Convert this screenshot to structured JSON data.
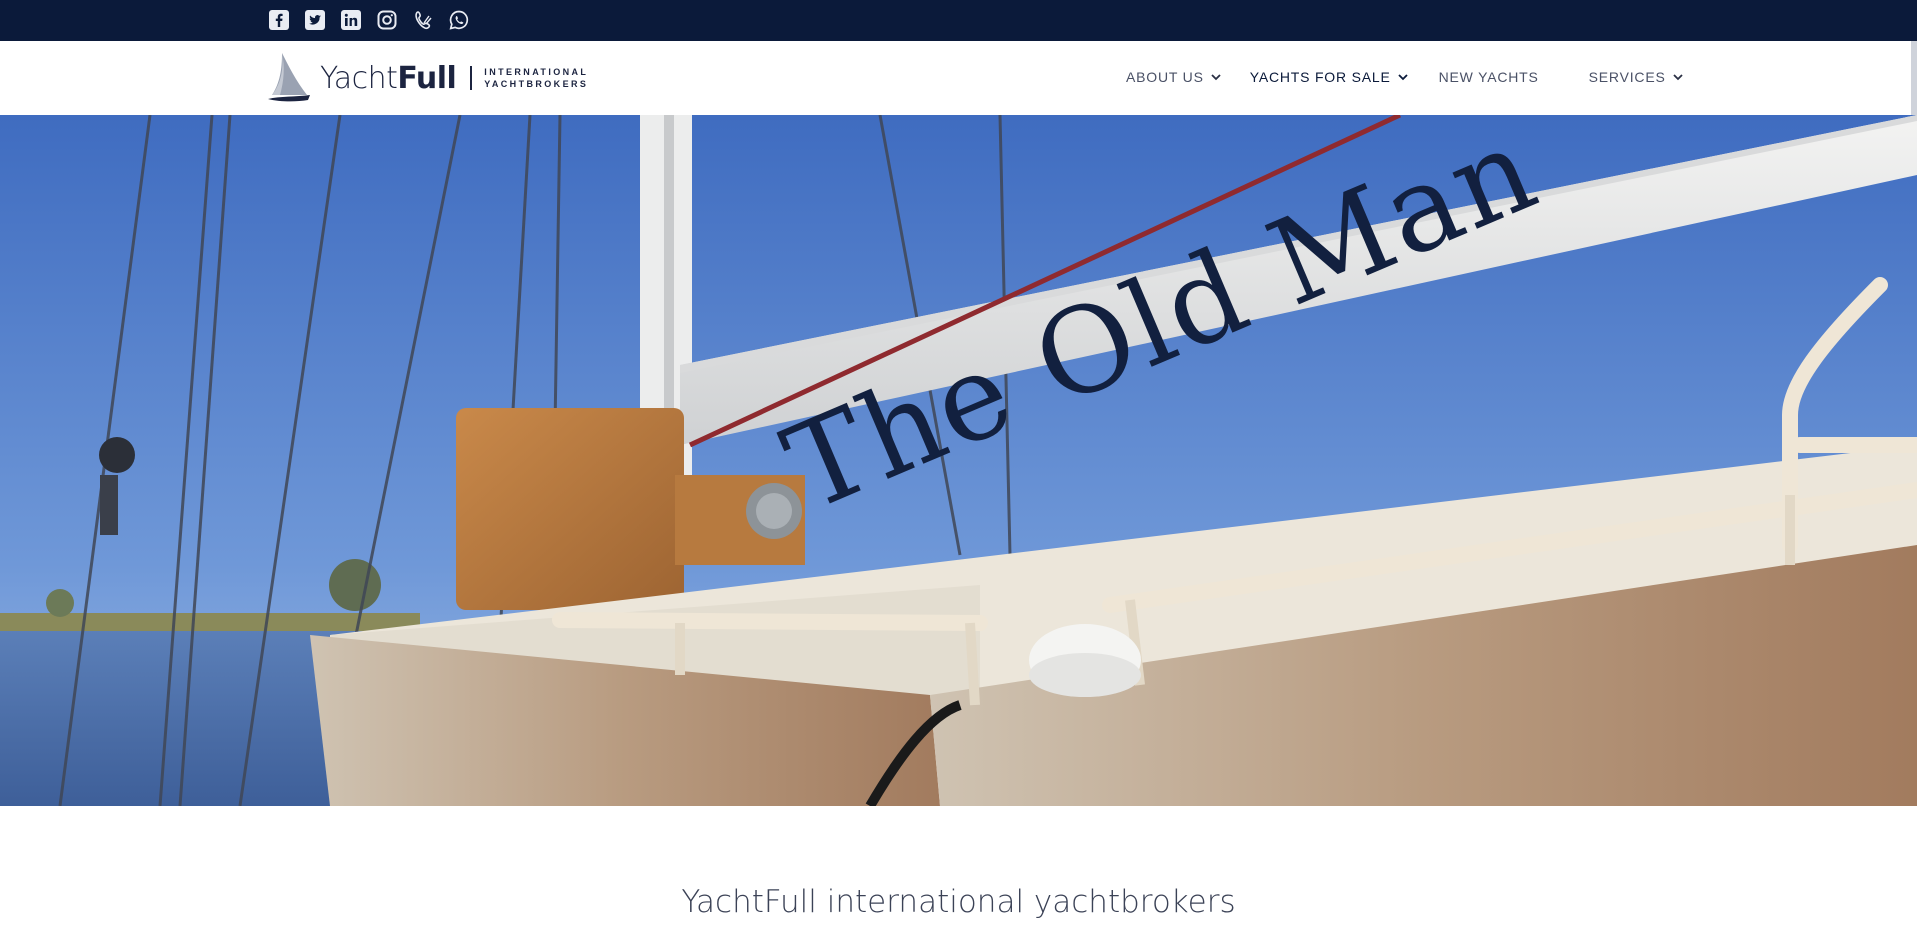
{
  "social": [
    {
      "name": "facebook-icon"
    },
    {
      "name": "twitter-icon"
    },
    {
      "name": "linkedin-icon"
    },
    {
      "name": "instagram-icon"
    },
    {
      "name": "phone-icon"
    },
    {
      "name": "whatsapp-icon"
    }
  ],
  "logo": {
    "word_light": "Yacht",
    "word_bold": "Full",
    "tag_line1": "INTERNATIONAL",
    "tag_line2": "YACHTBROKERS"
  },
  "nav": {
    "about": "ABOUT US",
    "yachts_for_sale": "YACHTS FOR SALE",
    "new_yachts": "NEW YACHTS",
    "services": "SERVICES"
  },
  "hero": {
    "boom_name": "The Old Man"
  },
  "intro": {
    "heading": "YachtFull international yachtbrokers"
  },
  "colors": {
    "topbar": "#0b1a3a",
    "text_dark": "#1c2440",
    "sky": "#4d79c7"
  }
}
